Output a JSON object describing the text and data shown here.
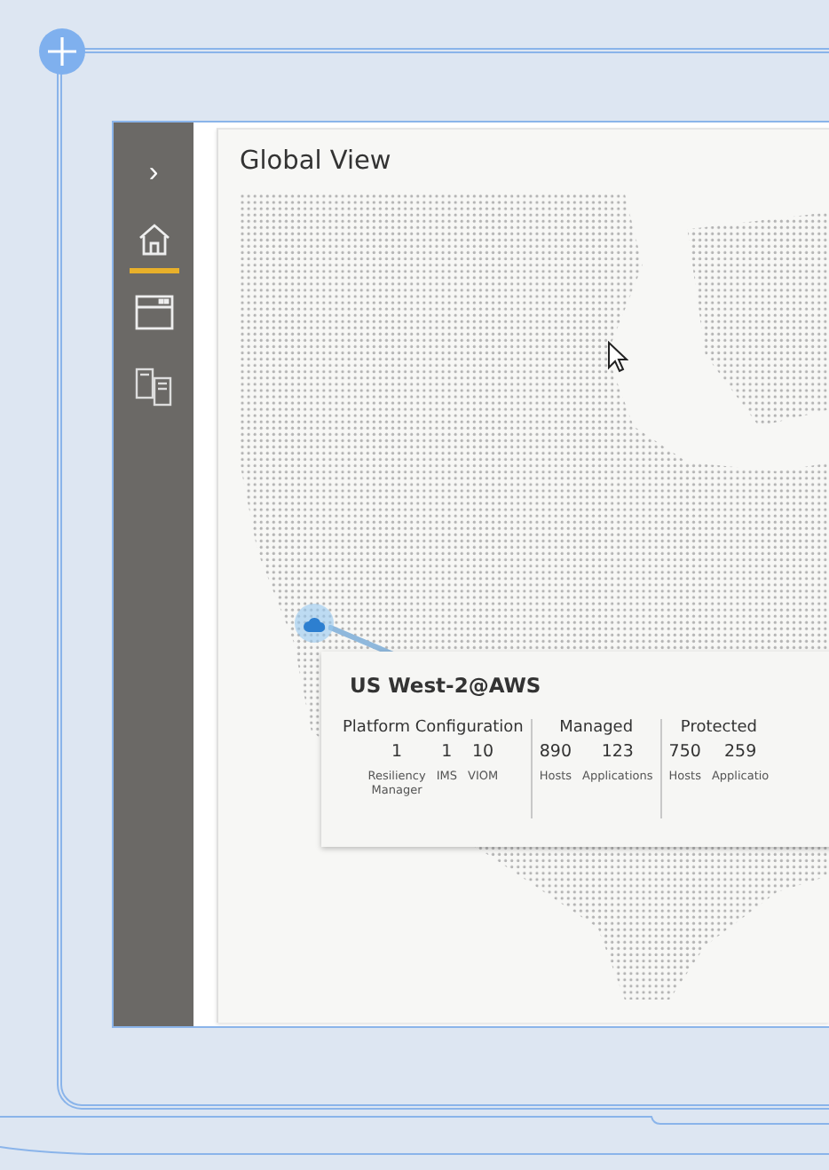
{
  "sidebar": {
    "expand": "›",
    "items": [
      {
        "kind": "home",
        "selected": true
      },
      {
        "kind": "window",
        "selected": false
      },
      {
        "kind": "servers",
        "selected": false
      }
    ]
  },
  "page": {
    "title": "Global View"
  },
  "popup": {
    "title": "US West-2@AWS",
    "sections": [
      {
        "heading": "Platform Configuration",
        "stats": [
          {
            "value": "1",
            "label": "Resiliency Manager"
          },
          {
            "value": "1",
            "label": "IMS"
          },
          {
            "value": "10",
            "label": "VIOM"
          }
        ]
      },
      {
        "heading": "Managed",
        "stats": [
          {
            "value": "890",
            "label": "Hosts"
          },
          {
            "value": "123",
            "label": "Applications"
          }
        ]
      },
      {
        "heading": "Protected",
        "stats": [
          {
            "value": "750",
            "label": "Hosts"
          },
          {
            "value": "259",
            "label": "Applicatio"
          }
        ]
      }
    ]
  }
}
